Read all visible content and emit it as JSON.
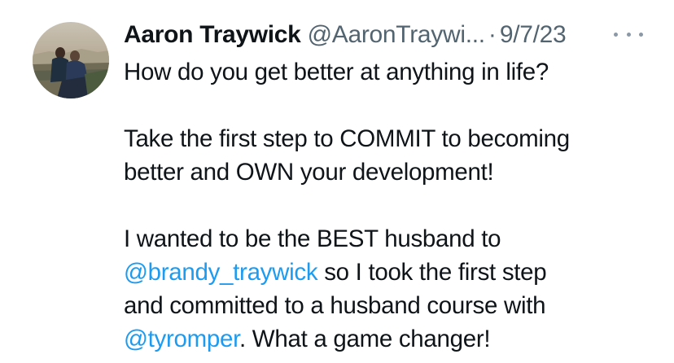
{
  "tweet": {
    "author_name": "Aaron Traywick",
    "handle": "@AaronTraywi...",
    "separator": "·",
    "date": "9/7/23",
    "more_icon": "more-horizontal-icon",
    "lines": {
      "l1": "How do you get better at anything in life?",
      "l2": "Take the first step to COMMIT to becoming",
      "l3": "better and OWN your development!",
      "l4": "I wanted to be the BEST husband to",
      "l5_mention": "@brandy_traywick",
      "l5_rest": " so I took the first step",
      "l6": "and committed to a husband course with",
      "l7_mention": "@tyromper",
      "l7_rest": ". What a game changer!"
    },
    "colors": {
      "text": "#0f1419",
      "secondary": "#536471",
      "link": "#1d9bf0"
    }
  }
}
